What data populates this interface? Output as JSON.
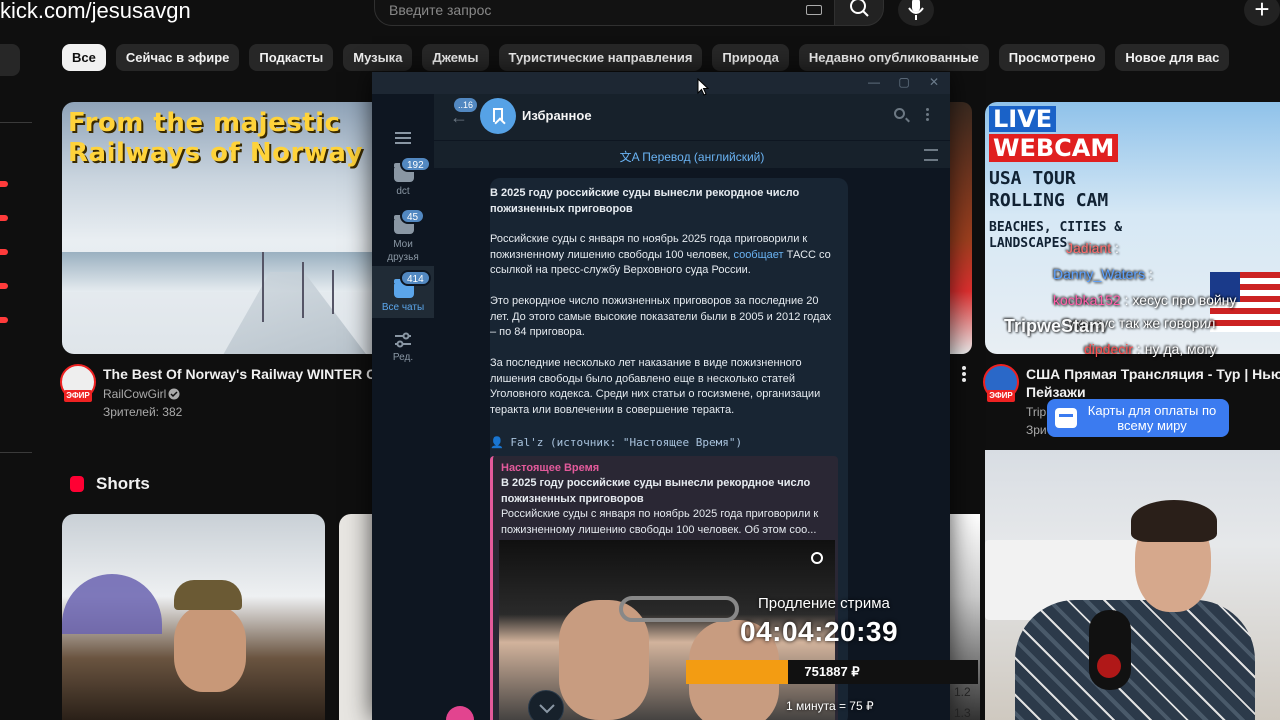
{
  "browser": {
    "url": "kick.com/jesusavgn"
  },
  "youtube": {
    "search_placeholder": "Введите запрос",
    "chips": [
      "Все",
      "Сейчас в эфире",
      "Подкасты",
      "Музыка",
      "Джемы",
      "Туристические направления",
      "Природа",
      "Недавно опубликованные",
      "Просмотрено",
      "Новое для вас"
    ],
    "video1": {
      "thumb_text_line1": "From the majestic",
      "thumb_text_line2": "Railways of Norway",
      "title": "The Best Of Norway's Railway WINTER Cab V",
      "channel": "RailCowGirl",
      "viewers": "Зрителей: 382",
      "live_badge": "ЭФИР"
    },
    "video2": {
      "thumb_live": "LIVE",
      "thumb_webcam": "WEBCAM",
      "thumb_tour_1": "USA TOUR",
      "thumb_tour_2": "ROLLING CAM",
      "thumb_small_1": "BEACHES, CITIES &",
      "thumb_small_2": "LANDSCAPES",
      "title_line1": "США Прямая Трансляция - Тур | Нью-Йо",
      "title_line2": "Пейзажи",
      "channel_partial": "Trip",
      "viewers_partial": "Зри",
      "live_badge": "ЭФИР"
    },
    "shorts_header": "Shorts"
  },
  "stream_chat": {
    "lines": [
      {
        "name": "Jadiant",
        "text": " :"
      },
      {
        "name": "Danny_Waters",
        "text": " :"
      },
      {
        "name": "kocbka152",
        "text": " : хесус про войну"
      },
      {
        "name": "",
        "text": "укр-рус так же говорил"
      },
      {
        "name": "dipdecir",
        "text": " : ну да, могу"
      }
    ],
    "tripwe_logo": "TripweStam",
    "cards_pill": "Карты для оплаты по всему миру"
  },
  "telegram": {
    "folders": [
      {
        "label": "dct",
        "badge": "192"
      },
      {
        "label": "Мои друзья",
        "badge": "45"
      },
      {
        "label": "Все чаты",
        "badge": "414"
      },
      {
        "label": "Ред.",
        "badge": ""
      }
    ],
    "back_badge": "..16",
    "chat_title": "Избранное",
    "translate_bar": "Перевод (английский)",
    "message": {
      "headline": "В 2025 году российские суды вынесли рекордное число пожизненных приговоров",
      "p1_a": "Российские суды с января по ноябрь 2025 года приговорили к пожизненному лишению свободы 100 человек, ",
      "p1_link": "сообщает",
      "p1_b": " ТАСС со ссылкой на пресс-службу Верховного суда России.",
      "p2": "Это рекордное число пожизненных приговоров за последние 20 лет. До этого самые высокие показатели были в 2005 и 2012 годах – по 84 приговора.",
      "p3": "За последние несколько лет наказание в виде пожизненного лишения свободы было добавлено еще в несколько статей Уголовного кодекса. Среди них статьи о госизмене, организации теракта или вовлечении в совершение теракта.",
      "forward_line": "👤 Fal'z (источник: \"Настоящее Время\")",
      "quote_source": "Настоящее Время",
      "quote_title": "В 2025 году российские суды вынесли рекордное число пожизненных приговоров",
      "quote_text": "Российские суды с января по ноябрь 2025 года приговорили к пожизненному лишению свободы 100 человек. Об этом соо..."
    }
  },
  "stream_overlay": {
    "extension_label": "Продление стрима",
    "timer": "04:04:20:39",
    "amount": "751887 ₽",
    "progress_fraction": 0.35,
    "rate": "1 минута = 75 ₽",
    "side_nums": [
      "1.2",
      "1.3"
    ]
  },
  "colors": {
    "accent": "#5288c1",
    "progress": "#f39c12",
    "quote_bar": "#e35a9b"
  }
}
